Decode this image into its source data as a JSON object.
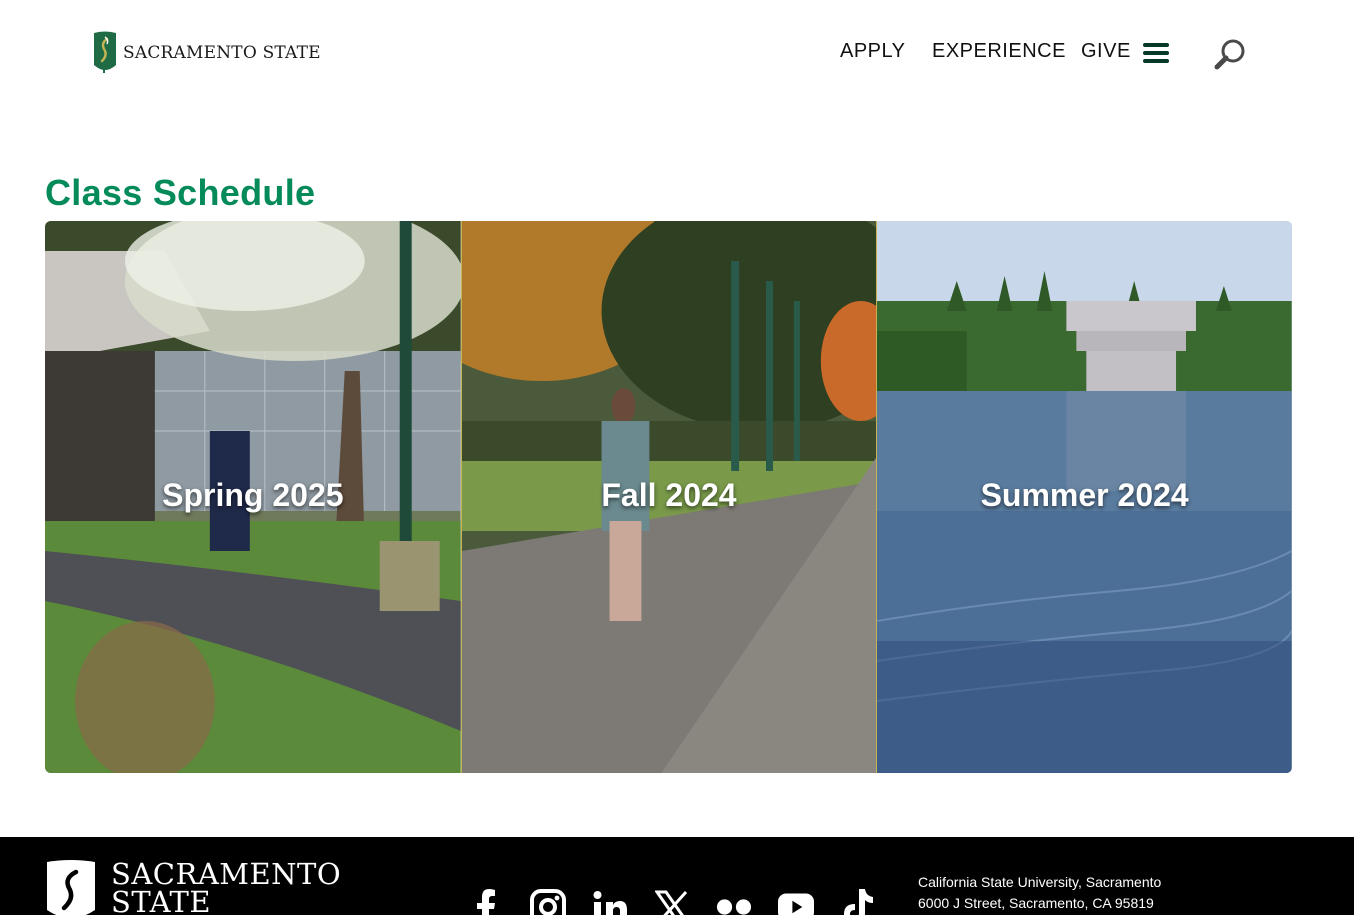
{
  "header": {
    "logo_text": "SACRAMENTO STATE",
    "nav": {
      "apply": "APPLY",
      "experience": "EXPERIENCE",
      "give": "GIVE"
    }
  },
  "main": {
    "title": "Class Schedule",
    "cards": [
      {
        "label": "Spring 2025"
      },
      {
        "label": "Fall 2024"
      },
      {
        "label": "Summer 2024"
      }
    ]
  },
  "footer": {
    "logo_line1": "SACRAMENTO",
    "logo_line2": "STATE",
    "address_line1": "California State University, Sacramento",
    "address_line2": "6000 J Street, Sacramento, CA  95819",
    "social_icons": [
      "facebook-icon",
      "instagram-icon",
      "linkedin-icon",
      "x-icon",
      "flickr-icon",
      "youtube-icon",
      "tiktok-icon"
    ]
  },
  "colors": {
    "brand_green": "#043927",
    "title_green": "#058b5a",
    "card_divider": "#c4b454",
    "footer_bg": "#000000"
  }
}
